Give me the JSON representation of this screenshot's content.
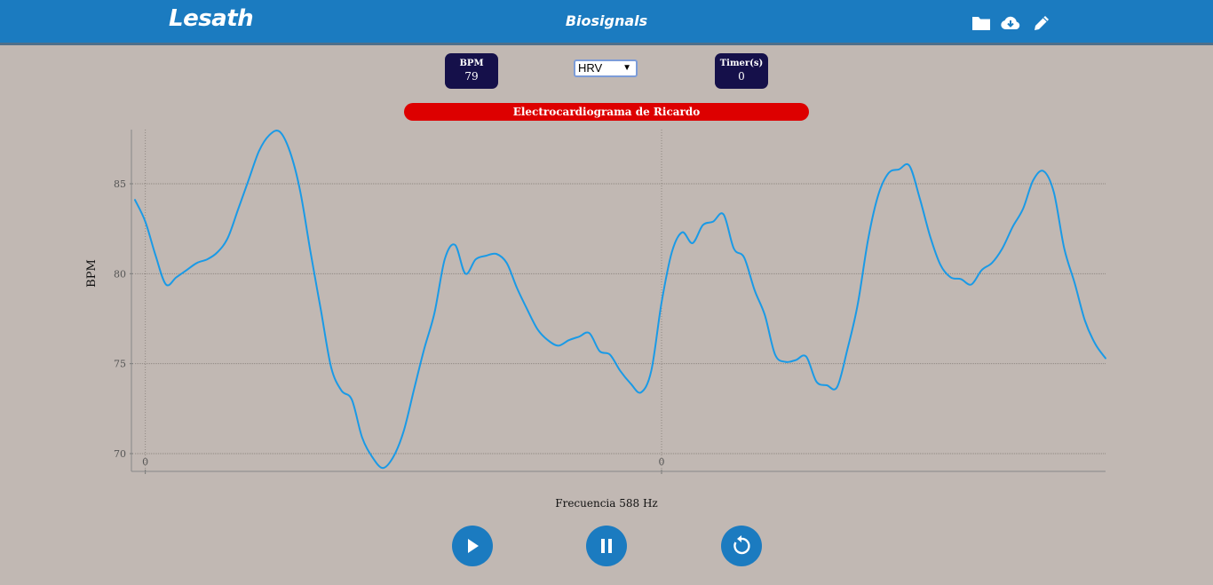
{
  "header": {
    "brand": "Lesath",
    "title": "Biosignals"
  },
  "stats": {
    "bpm_label": "BPM",
    "bpm_value": "79",
    "timer_label": "Timer(s)",
    "timer_value": "0"
  },
  "mode_select": {
    "selected": "HRV"
  },
  "chart_banner": "Electrocardiograma de Ricardo",
  "frequency_label": "Frecuencia 588 Hz",
  "icons": {
    "folder": "folder-icon",
    "download": "cloud-download-icon",
    "edit": "pencil-icon",
    "play": "play-icon",
    "pause": "pause-icon",
    "restart": "restart-icon"
  },
  "colors": {
    "header": "#1b7bc0",
    "background": "#c1b8b3",
    "stat_box": "#15104a",
    "banner": "#dd0000",
    "series_line": "#1a9ae6",
    "button": "#1b7bc0"
  },
  "chart_data": {
    "type": "line",
    "title": "Electrocardiograma de Ricardo",
    "ylabel": "BPM",
    "xlabel": "Frecuencia 588 Hz",
    "ylim": [
      69,
      88
    ],
    "xlim": [
      0,
      188
    ],
    "yticks": [
      70,
      75,
      80,
      85
    ],
    "xticks": [
      {
        "x": 2,
        "label": "0"
      },
      {
        "x": 102,
        "label": "0"
      }
    ],
    "grid": true,
    "x": [
      0,
      2,
      4,
      6,
      8,
      10,
      12,
      14,
      16,
      18,
      20,
      22,
      24,
      26,
      28,
      30,
      32,
      34,
      36,
      38,
      40,
      42,
      44,
      46,
      48,
      50,
      52,
      54,
      56,
      58,
      60,
      62,
      64,
      66,
      68,
      70,
      72,
      74,
      76,
      78,
      80,
      82,
      84,
      86,
      88,
      90,
      92,
      94,
      96,
      98,
      100,
      102,
      104,
      106,
      108,
      110,
      112,
      114,
      116,
      118,
      120,
      122,
      124,
      126,
      128,
      130,
      132,
      134,
      136,
      138,
      140,
      142,
      144,
      146,
      148,
      150,
      152,
      154,
      156,
      158,
      160,
      162,
      164,
      166,
      168,
      170,
      172,
      174,
      176,
      178,
      180,
      182,
      184,
      186,
      188
    ],
    "y": [
      84.1,
      82.9,
      81.0,
      79.4,
      79.8,
      80.2,
      80.6,
      80.8,
      81.2,
      82.0,
      83.6,
      85.2,
      86.8,
      87.7,
      87.9,
      86.8,
      84.6,
      81.2,
      78.0,
      74.8,
      73.5,
      73.0,
      70.9,
      69.8,
      69.2,
      69.8,
      71.2,
      73.5,
      75.8,
      77.8,
      80.8,
      81.6,
      80.0,
      80.8,
      81.0,
      81.1,
      80.6,
      79.2,
      78.0,
      76.9,
      76.3,
      76.0,
      76.3,
      76.5,
      76.7,
      75.7,
      75.5,
      74.6,
      73.9,
      73.4,
      74.6,
      78.4,
      81.2,
      82.3,
      81.7,
      82.7,
      82.9,
      83.3,
      81.4,
      80.9,
      79.1,
      77.7,
      75.5,
      75.1,
      75.2,
      75.4,
      74.0,
      73.8,
      73.7,
      75.8,
      78.3,
      81.9,
      84.4,
      85.6,
      85.8,
      86.0,
      84.2,
      82.1,
      80.5,
      79.8,
      79.7,
      79.4,
      80.2,
      80.6,
      81.4,
      82.6,
      83.6,
      85.2,
      85.7,
      84.5,
      81.4,
      79.5,
      77.4,
      76.1,
      75.3
    ]
  }
}
